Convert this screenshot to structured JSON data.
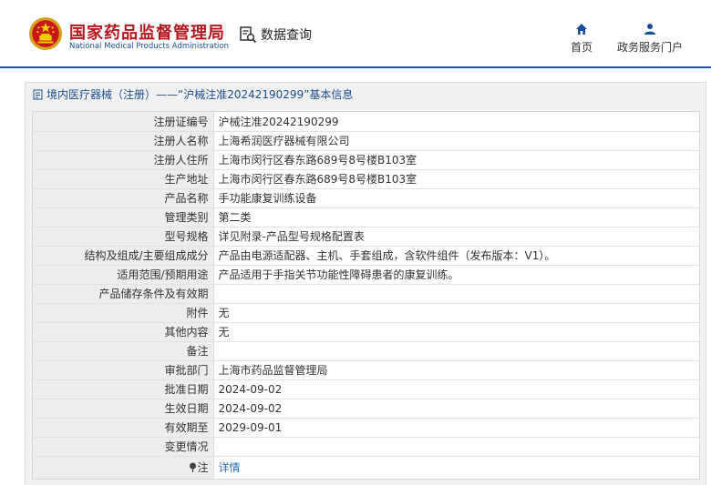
{
  "header": {
    "brand_cn": "国家药品监督管理局",
    "brand_en": "National Medical Products Administration",
    "db_query_label": "数据查询",
    "nav": {
      "home_label": "首页",
      "portal_label": "政务服务门户"
    }
  },
  "panel": {
    "title": "境内医疗器械（注册）——“沪械注准20242190299”基本信息"
  },
  "rows": [
    {
      "key": "注册证编号",
      "value": "沪械注准20242190299"
    },
    {
      "key": "注册人名称",
      "value": "上海希润医疗器械有限公司"
    },
    {
      "key": "注册人住所",
      "value": "上海市闵行区春东路689号8号楼B103室"
    },
    {
      "key": "生产地址",
      "value": "上海市闵行区春东路689号8号楼B103室"
    },
    {
      "key": "产品名称",
      "value": "手功能康复训练设备"
    },
    {
      "key": "管理类别",
      "value": "第二类"
    },
    {
      "key": "型号规格",
      "value": "详见附录-产品型号规格配置表"
    },
    {
      "key": "结构及组成/主要组成成分",
      "value": "产品由电源适配器、主机、手套组成，含软件组件（发布版本：V1）。"
    },
    {
      "key": "适用范围/预期用途",
      "value": "产品适用于手指关节功能性障碍患者的康复训练。"
    },
    {
      "key": "产品储存条件及有效期",
      "value": ""
    },
    {
      "key": "附件",
      "value": "无"
    },
    {
      "key": "其他内容",
      "value": "无"
    },
    {
      "key": "备注",
      "value": ""
    },
    {
      "key": "审批部门",
      "value": "上海市药品监督管理局"
    },
    {
      "key": "批准日期",
      "value": "2024-09-02"
    },
    {
      "key": "生效日期",
      "value": "2024-09-02"
    },
    {
      "key": "有效期至",
      "value": "2029-09-01"
    },
    {
      "key": "变更情况",
      "value": ""
    }
  ],
  "note_row": {
    "key": "注",
    "link_label": "详情"
  },
  "colors": {
    "brand_red": "#b5161f",
    "brand_blue": "#1a56a8",
    "link_blue": "#2b6fbe"
  },
  "icons": {
    "emblem": "national-emblem-icon",
    "db_query": "document-search-icon",
    "home": "home-icon",
    "portal": "user-icon",
    "title": "document-icon",
    "note": "pin-icon"
  }
}
